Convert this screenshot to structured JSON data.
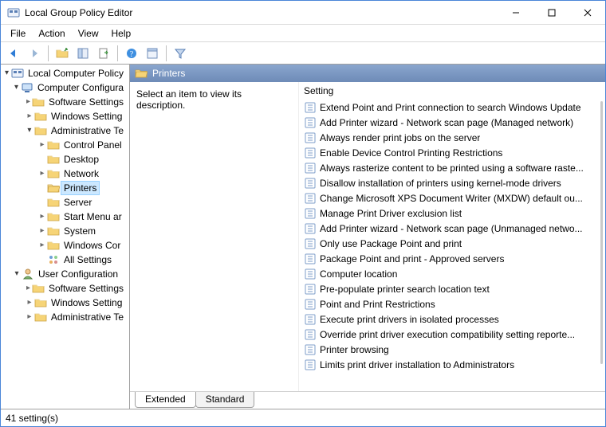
{
  "window": {
    "title": "Local Group Policy Editor"
  },
  "menu": {
    "file": "File",
    "action": "Action",
    "view": "View",
    "help": "Help"
  },
  "tree": {
    "root": "Local Computer Policy",
    "computer_config": "Computer Configura",
    "software_settings": "Software Settings",
    "windows_settings": "Windows Setting",
    "admin_templates": "Administrative Te",
    "control_panel": "Control Panel",
    "desktop": "Desktop",
    "network": "Network",
    "printers": "Printers",
    "server": "Server",
    "start_menu": "Start Menu ar",
    "system": "System",
    "windows_comp": "Windows Cor",
    "all_settings": "All Settings",
    "user_config": "User Configuration",
    "user_software": "Software Settings",
    "user_windows": "Windows Setting",
    "user_admin": "Administrative Te"
  },
  "content": {
    "folder_title": "Printers",
    "description_prompt": "Select an item to view its description.",
    "column_setting": "Setting",
    "tabs": {
      "extended": "Extended",
      "standard": "Standard"
    },
    "items": [
      "Extend Point and Print connection to search Windows Update",
      "Add Printer wizard - Network scan page (Managed network)",
      "Always render print jobs on the server",
      "Enable Device Control Printing Restrictions",
      "Always rasterize content to be printed using a software raste...",
      "Disallow installation of printers using kernel-mode drivers",
      "Change Microsoft XPS Document Writer (MXDW) default ou...",
      "Manage Print Driver exclusion list",
      "Add Printer wizard - Network scan page (Unmanaged netwo...",
      "Only use Package Point and print",
      "Package Point and print - Approved servers",
      "Computer location",
      "Pre-populate printer search location text",
      "Point and Print Restrictions",
      "Execute print drivers in isolated processes",
      "Override print driver execution compatibility setting reporte...",
      "Printer browsing",
      "Limits print driver installation to Administrators"
    ]
  },
  "status": {
    "count": "41 setting(s)"
  }
}
